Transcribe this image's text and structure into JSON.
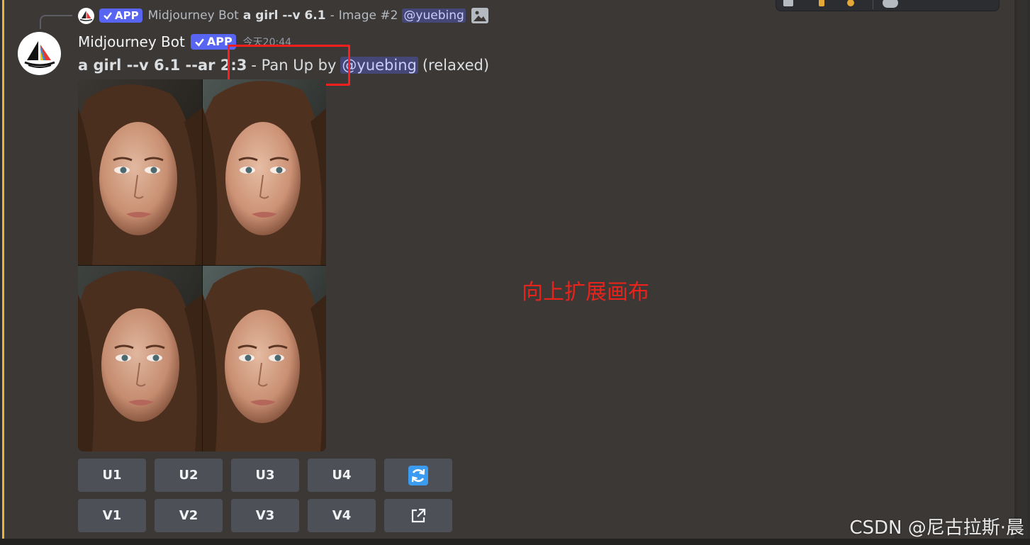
{
  "reply": {
    "badge": "APP",
    "author": "Midjourney Bot",
    "prompt": "a girl --v 6.1",
    "separator": "-",
    "suffix": "Image #2",
    "mention": "@yuebing"
  },
  "message": {
    "username": "Midjourney Bot",
    "badge": "APP",
    "timestamp": "今天20:44",
    "prompt": "a girl --v 6.1 --ar 2:3",
    "action": "- Pan Up by",
    "mention": "@yuebing",
    "mode": "(relaxed)"
  },
  "image_grid": {
    "tiles": [
      {
        "label": "image-1"
      },
      {
        "label": "image-2"
      },
      {
        "label": "image-3"
      },
      {
        "label": "image-4"
      }
    ]
  },
  "buttons": {
    "upscale": [
      "U1",
      "U2",
      "U3",
      "U4"
    ],
    "variation": [
      "V1",
      "V2",
      "V3",
      "V4"
    ],
    "reroll_icon": "refresh-icon",
    "open_icon": "external-link-icon"
  },
  "annotation": "向上扩展画布",
  "watermark": "CSDN @尼古拉斯·晨",
  "colors": {
    "background": "#3b3836",
    "app_badge": "#5865f2",
    "button": "#4e5058",
    "mention_bar": "#e9b33a",
    "highlight": "#ff1e1e",
    "annotation": "#e8231b",
    "reroll_icon": "#3b9bf0"
  }
}
